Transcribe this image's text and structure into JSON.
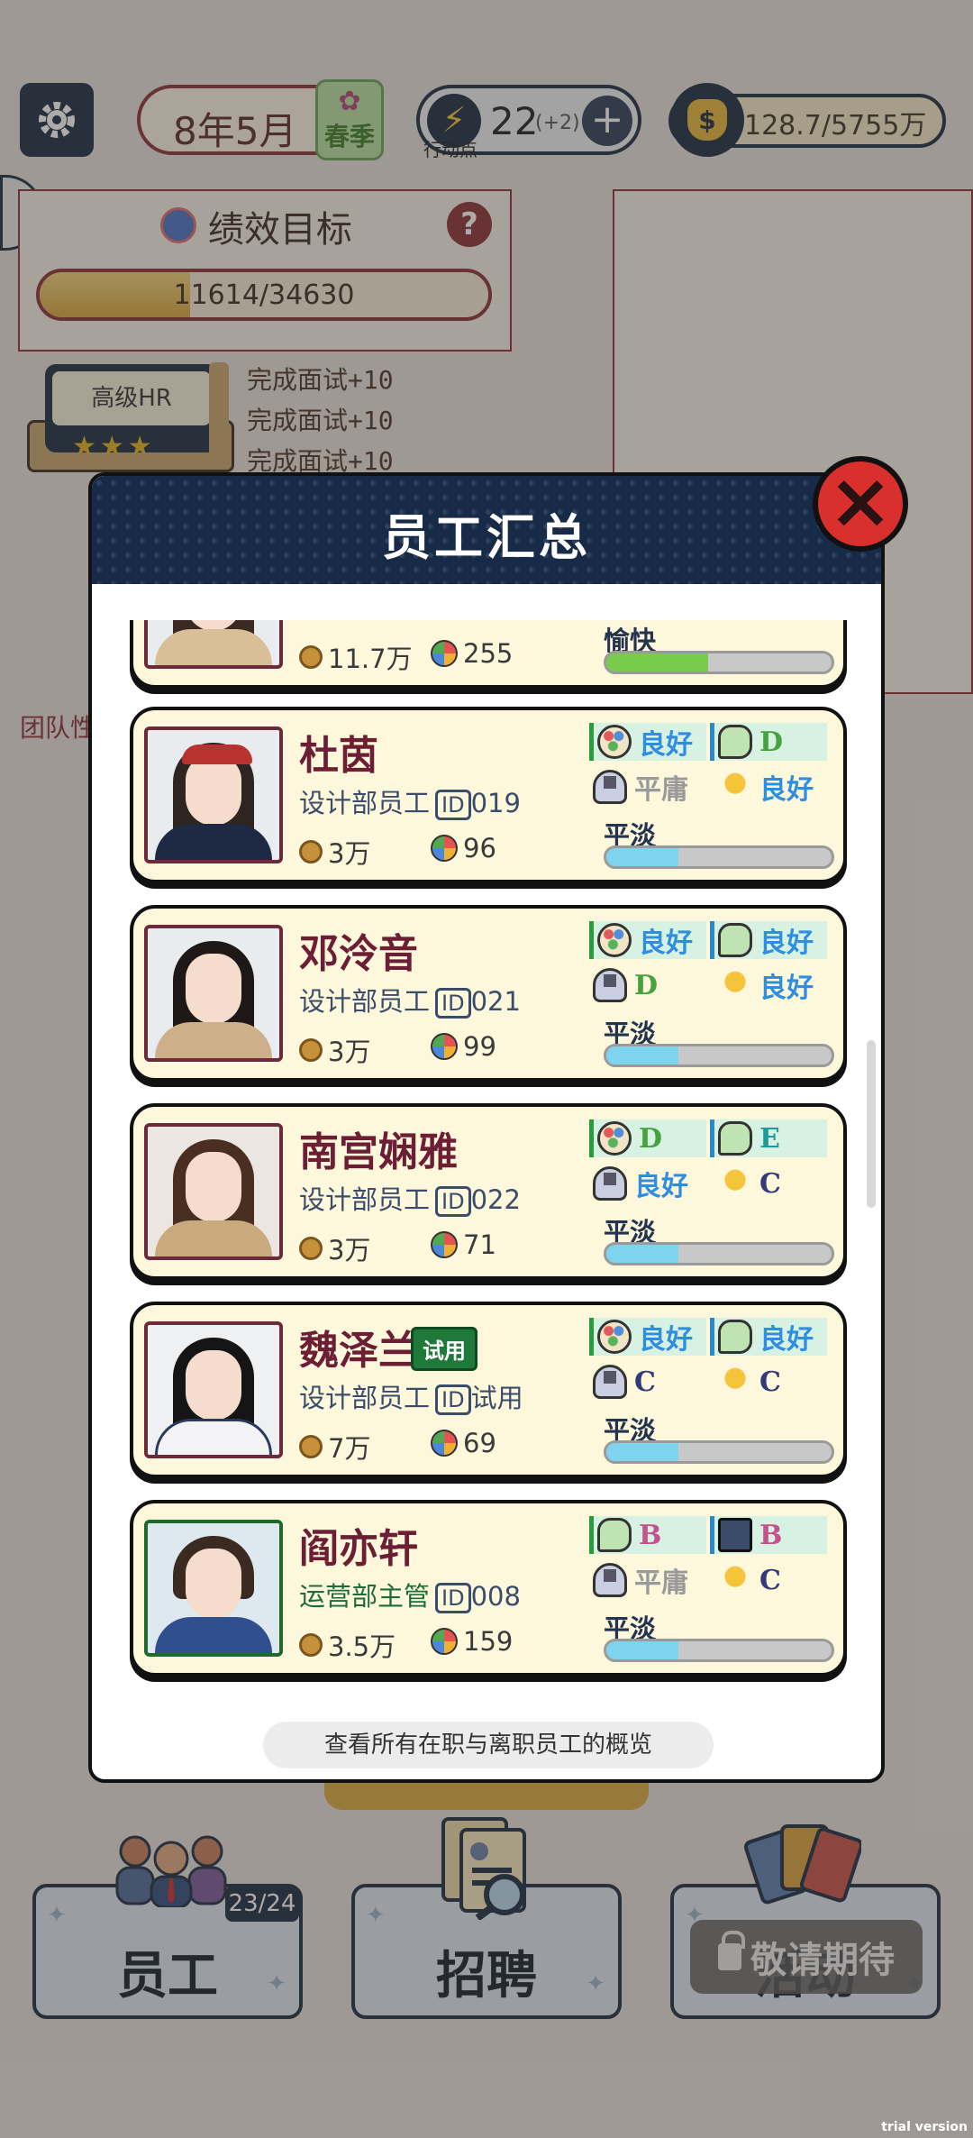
{
  "hud": {
    "date": "8年5月",
    "season": "春季",
    "action_points": "22",
    "action_points_bonus": "(+2)",
    "action_points_caption": "行动点",
    "money": "128.7/5755万"
  },
  "goal": {
    "title": "绩效目标",
    "help": "?",
    "progress_text": "11614/34630",
    "progress": 0.335
  },
  "hr": {
    "title": "高级HR",
    "stars": "★★★",
    "tasks": [
      "完成面试+10",
      "完成面试+10",
      "完成面试+10"
    ]
  },
  "team_label": "团队性",
  "modal": {
    "title": "员工汇总",
    "close": "×",
    "footer": "查看所有在职与离职员工的概览"
  },
  "employees": [
    {
      "name": "",
      "salary": "11.7万",
      "perf": "255",
      "mood": "愉快",
      "mood_level": 0.45
    },
    {
      "name": "杜茵",
      "dept": "设计部员工",
      "id_label": "ID",
      "id": "019",
      "salary": "3万",
      "perf": "96",
      "skills": [
        "良好",
        "D",
        "平庸",
        "良好"
      ],
      "mood": "平淡",
      "mood_level": 0.32
    },
    {
      "name": "邓泠音",
      "dept": "设计部员工",
      "id_label": "ID",
      "id": "021",
      "salary": "3万",
      "perf": "99",
      "skills": [
        "良好",
        "良好",
        "D",
        "良好"
      ],
      "mood": "平淡",
      "mood_level": 0.32
    },
    {
      "name": "南宫娴雅",
      "dept": "设计部员工",
      "id_label": "ID",
      "id": "022",
      "salary": "3万",
      "perf": "71",
      "skills": [
        "D",
        "E",
        "良好",
        "C"
      ],
      "mood": "平淡",
      "mood_level": 0.32
    },
    {
      "name": "魏泽兰",
      "tag": "试用",
      "dept": "设计部员工",
      "id_label": "ID",
      "id": "试用",
      "salary": "7万",
      "perf": "69",
      "skills": [
        "良好",
        "良好",
        "C",
        "C"
      ],
      "mood": "平淡",
      "mood_level": 0.32
    },
    {
      "name": "阎亦轩",
      "dept": "运营部主管",
      "id_label": "ID",
      "id": "008",
      "salary": "3.5万",
      "perf": "159",
      "skills": [
        "B",
        "B",
        "平庸",
        "C"
      ],
      "mood": "平淡",
      "mood_level": 0.32
    }
  ],
  "nav": {
    "staff": "员工",
    "staff_count": "23/24",
    "recruit": "招聘",
    "event": "活动",
    "locked": "敬请期待"
  },
  "watermark": "trial version",
  "icons": {
    "settings": "gear-icon",
    "calendar": "calendar-icon",
    "lightning": "lightning-icon",
    "add": "plus-icon",
    "money": "money-bag-icon",
    "close": "close-icon",
    "lock": "lock-icon"
  },
  "colors": {
    "navy": "#172a47",
    "maroon": "#8a2f38",
    "close_red": "#d9302d",
    "card_bg": "#fdf7dc",
    "good_blue": "#2f8ee0"
  }
}
